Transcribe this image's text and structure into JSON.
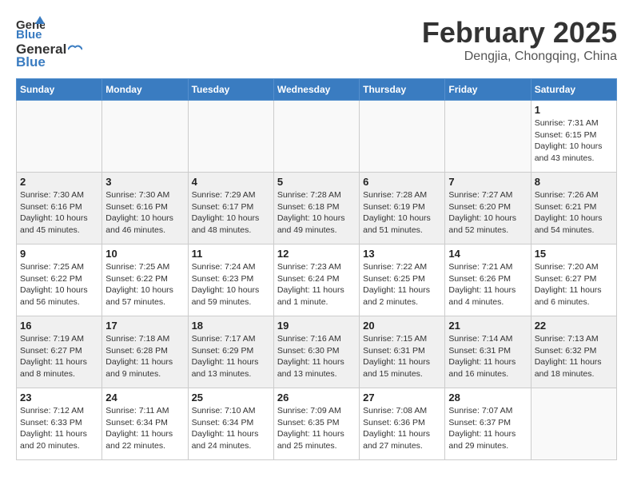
{
  "header": {
    "logo": {
      "general": "General",
      "blue": "Blue"
    },
    "title": "February 2025",
    "location": "Dengjia, Chongqing, China"
  },
  "weekdays": [
    "Sunday",
    "Monday",
    "Tuesday",
    "Wednesday",
    "Thursday",
    "Friday",
    "Saturday"
  ],
  "weeks": [
    [
      {
        "day": "",
        "info": ""
      },
      {
        "day": "",
        "info": ""
      },
      {
        "day": "",
        "info": ""
      },
      {
        "day": "",
        "info": ""
      },
      {
        "day": "",
        "info": ""
      },
      {
        "day": "",
        "info": ""
      },
      {
        "day": "1",
        "info": "Sunrise: 7:31 AM\nSunset: 6:15 PM\nDaylight: 10 hours\nand 43 minutes."
      }
    ],
    [
      {
        "day": "2",
        "info": "Sunrise: 7:30 AM\nSunset: 6:16 PM\nDaylight: 10 hours\nand 45 minutes."
      },
      {
        "day": "3",
        "info": "Sunrise: 7:30 AM\nSunset: 6:16 PM\nDaylight: 10 hours\nand 46 minutes."
      },
      {
        "day": "4",
        "info": "Sunrise: 7:29 AM\nSunset: 6:17 PM\nDaylight: 10 hours\nand 48 minutes."
      },
      {
        "day": "5",
        "info": "Sunrise: 7:28 AM\nSunset: 6:18 PM\nDaylight: 10 hours\nand 49 minutes."
      },
      {
        "day": "6",
        "info": "Sunrise: 7:28 AM\nSunset: 6:19 PM\nDaylight: 10 hours\nand 51 minutes."
      },
      {
        "day": "7",
        "info": "Sunrise: 7:27 AM\nSunset: 6:20 PM\nDaylight: 10 hours\nand 52 minutes."
      },
      {
        "day": "8",
        "info": "Sunrise: 7:26 AM\nSunset: 6:21 PM\nDaylight: 10 hours\nand 54 minutes."
      }
    ],
    [
      {
        "day": "9",
        "info": "Sunrise: 7:25 AM\nSunset: 6:22 PM\nDaylight: 10 hours\nand 56 minutes."
      },
      {
        "day": "10",
        "info": "Sunrise: 7:25 AM\nSunset: 6:22 PM\nDaylight: 10 hours\nand 57 minutes."
      },
      {
        "day": "11",
        "info": "Sunrise: 7:24 AM\nSunset: 6:23 PM\nDaylight: 10 hours\nand 59 minutes."
      },
      {
        "day": "12",
        "info": "Sunrise: 7:23 AM\nSunset: 6:24 PM\nDaylight: 11 hours\nand 1 minute."
      },
      {
        "day": "13",
        "info": "Sunrise: 7:22 AM\nSunset: 6:25 PM\nDaylight: 11 hours\nand 2 minutes."
      },
      {
        "day": "14",
        "info": "Sunrise: 7:21 AM\nSunset: 6:26 PM\nDaylight: 11 hours\nand 4 minutes."
      },
      {
        "day": "15",
        "info": "Sunrise: 7:20 AM\nSunset: 6:27 PM\nDaylight: 11 hours\nand 6 minutes."
      }
    ],
    [
      {
        "day": "16",
        "info": "Sunrise: 7:19 AM\nSunset: 6:27 PM\nDaylight: 11 hours\nand 8 minutes."
      },
      {
        "day": "17",
        "info": "Sunrise: 7:18 AM\nSunset: 6:28 PM\nDaylight: 11 hours\nand 9 minutes."
      },
      {
        "day": "18",
        "info": "Sunrise: 7:17 AM\nSunset: 6:29 PM\nDaylight: 11 hours\nand 13 minutes."
      },
      {
        "day": "19",
        "info": "Sunrise: 7:16 AM\nSunset: 6:30 PM\nDaylight: 11 hours\nand 13 minutes."
      },
      {
        "day": "20",
        "info": "Sunrise: 7:15 AM\nSunset: 6:31 PM\nDaylight: 11 hours\nand 15 minutes."
      },
      {
        "day": "21",
        "info": "Sunrise: 7:14 AM\nSunset: 6:31 PM\nDaylight: 11 hours\nand 16 minutes."
      },
      {
        "day": "22",
        "info": "Sunrise: 7:13 AM\nSunset: 6:32 PM\nDaylight: 11 hours\nand 18 minutes."
      }
    ],
    [
      {
        "day": "23",
        "info": "Sunrise: 7:12 AM\nSunset: 6:33 PM\nDaylight: 11 hours\nand 20 minutes."
      },
      {
        "day": "24",
        "info": "Sunrise: 7:11 AM\nSunset: 6:34 PM\nDaylight: 11 hours\nand 22 minutes."
      },
      {
        "day": "25",
        "info": "Sunrise: 7:10 AM\nSunset: 6:34 PM\nDaylight: 11 hours\nand 24 minutes."
      },
      {
        "day": "26",
        "info": "Sunrise: 7:09 AM\nSunset: 6:35 PM\nDaylight: 11 hours\nand 25 minutes."
      },
      {
        "day": "27",
        "info": "Sunrise: 7:08 AM\nSunset: 6:36 PM\nDaylight: 11 hours\nand 27 minutes."
      },
      {
        "day": "28",
        "info": "Sunrise: 7:07 AM\nSunset: 6:37 PM\nDaylight: 11 hours\nand 29 minutes."
      },
      {
        "day": "",
        "info": ""
      }
    ]
  ]
}
